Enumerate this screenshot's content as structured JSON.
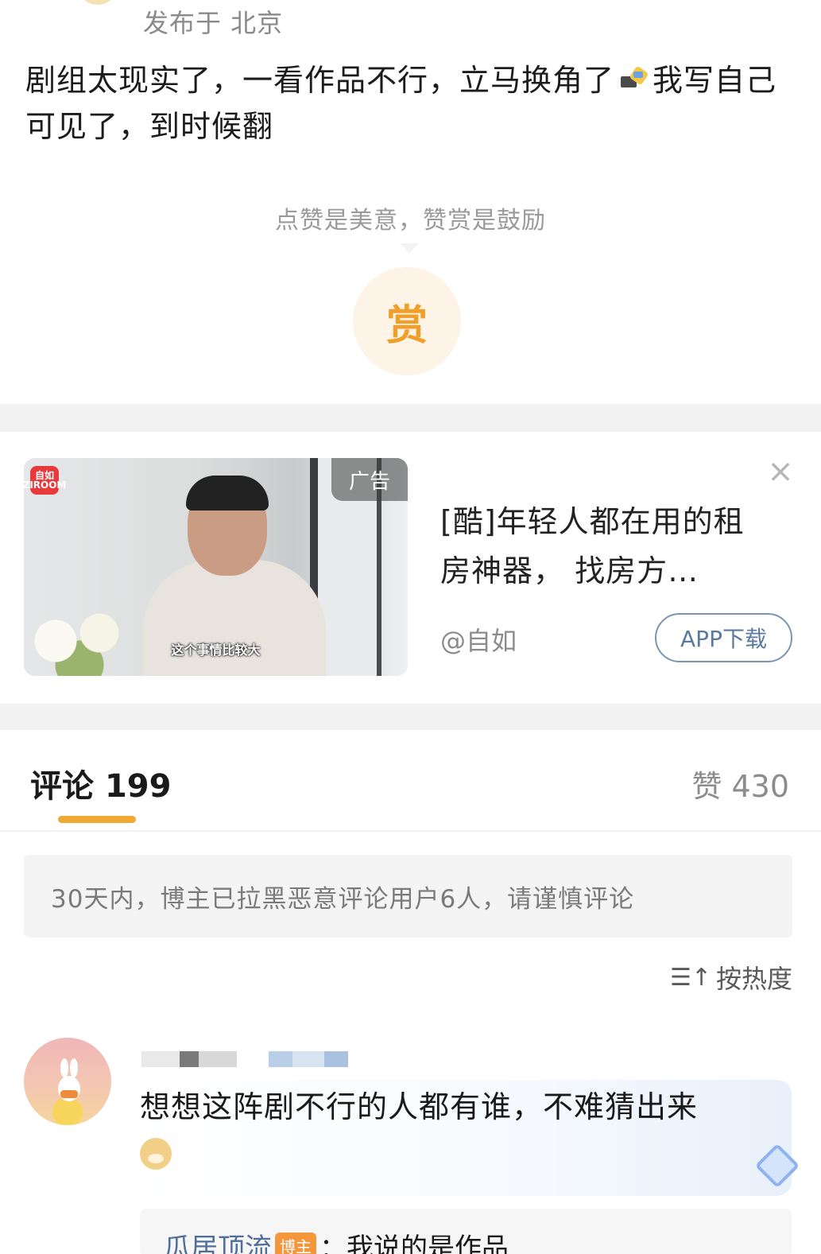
{
  "post": {
    "location": "发布于 北京",
    "text_before_emoji": "剧组太现实了，一看作品不行，立马换角了",
    "text_after_emoji": "我写自己可见了，到时候翻",
    "inline_emoji": "clapboard-icon",
    "reward_hint": "点赞是美意，赞赏是鼓励",
    "reward_label": "赏"
  },
  "ad": {
    "logo_text": "自如 ZIROOM",
    "tag": "广告",
    "video_subtitle": "这个事情比较大",
    "title": "[酷]年轻人都在用的租房神器， 找房方…",
    "source": "@自如",
    "cta": "APP下载",
    "close_icon": "close-icon"
  },
  "comments": {
    "tab_label": "评论",
    "count": "199",
    "likes_label": "赞",
    "likes_count": "430",
    "notice": "30天内，博主已拉黑恶意评论用户6人，请谨慎评论",
    "sort_label": "按热度",
    "sort_icon": "sort-icon",
    "items": [
      {
        "text": "想想这阵剧不行的人都有谁，不难猜出来",
        "emoji": "doge-icon",
        "reply": {
          "name": "瓜居顶流",
          "tag": "博主",
          "text": "：我说的是作品"
        }
      }
    ]
  },
  "colors": {
    "accent": "#f0a933",
    "reward": "#f0a02a",
    "link": "#5a7aa0"
  }
}
